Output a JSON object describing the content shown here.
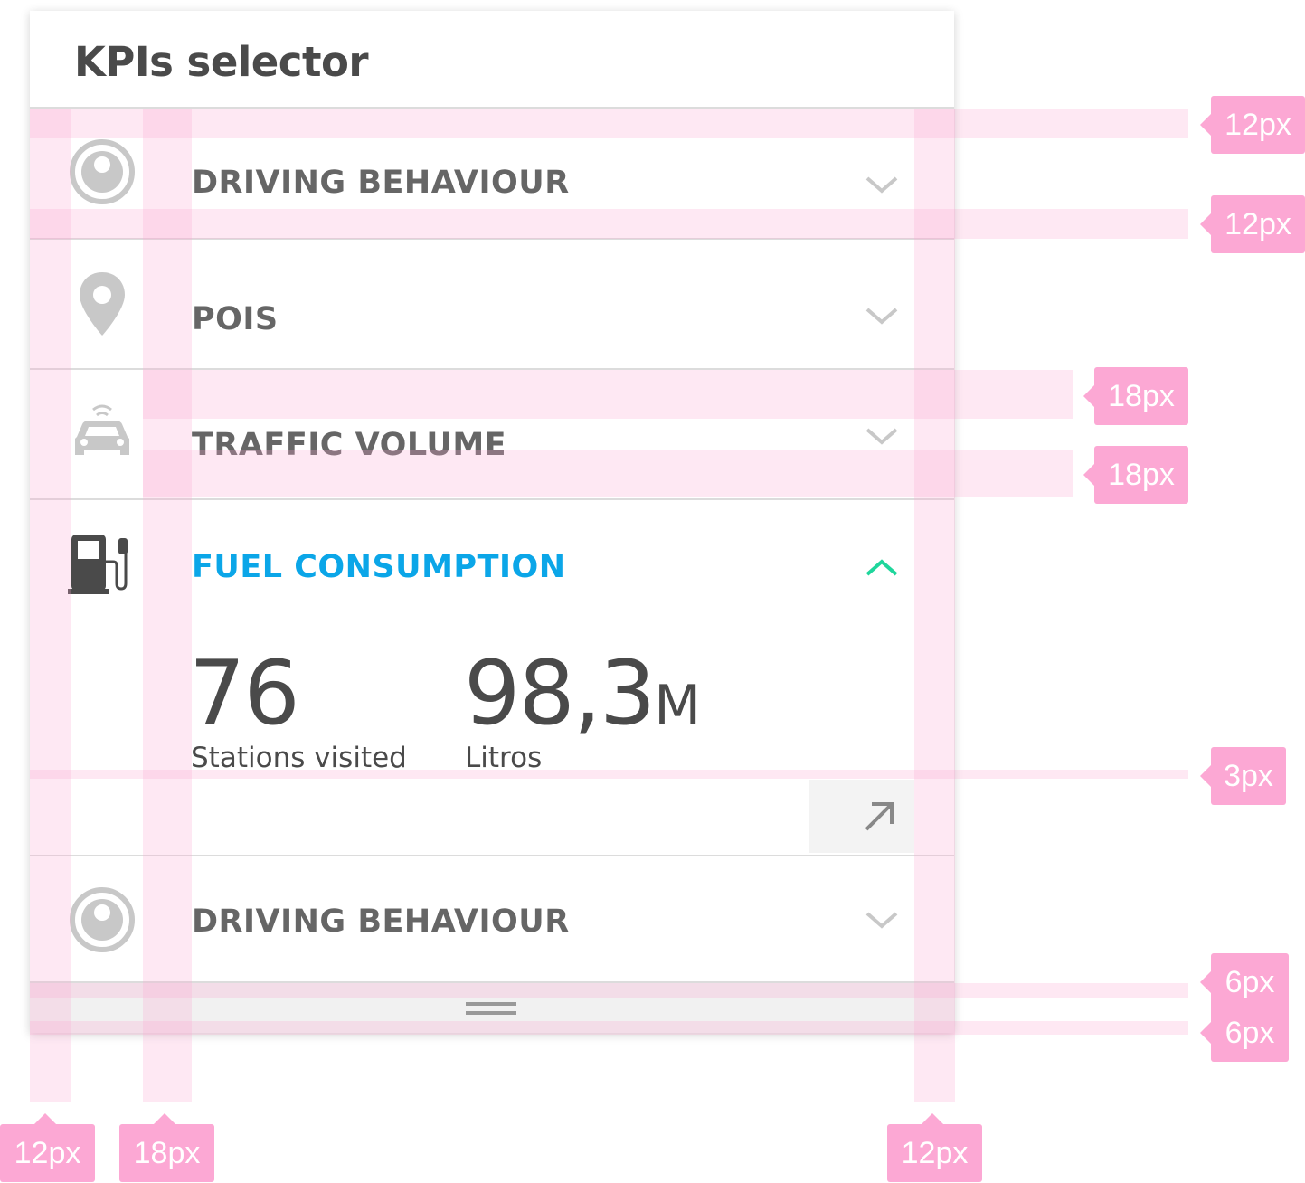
{
  "panel": {
    "title": "KPIs selector"
  },
  "rows": [
    {
      "label": "DRIVING BEHAVIOUR",
      "icon": "steering-wheel-icon",
      "state": "collapsed"
    },
    {
      "label": "POIS",
      "icon": "map-pin-icon",
      "state": "collapsed"
    },
    {
      "label": "TRAFFIC VOLUME",
      "icon": "connected-car-icon",
      "state": "collapsed"
    },
    {
      "label": "FUEL CONSUMPTION",
      "icon": "fuel-pump-icon",
      "state": "expanded",
      "metrics": [
        {
          "value": "76",
          "unit": "",
          "label": "Stations visited"
        },
        {
          "value": "98,3",
          "unit": "M",
          "label": "Litros"
        }
      ]
    },
    {
      "label": "DRIVING BEHAVIOUR",
      "icon": "steering-wheel-icon",
      "state": "collapsed"
    }
  ],
  "spec": {
    "right": [
      "12px",
      "12px",
      "18px",
      "18px",
      "3px",
      "6px",
      "6px"
    ],
    "bottom": [
      "12px",
      "18px",
      "12px"
    ]
  },
  "colors": {
    "active_label": "#0ba6e8",
    "active_chevron": "#1fd69c",
    "text": "#4a4a4a",
    "icon_inactive": "#c8c8c8",
    "spec_tag": "#fca8d4"
  }
}
